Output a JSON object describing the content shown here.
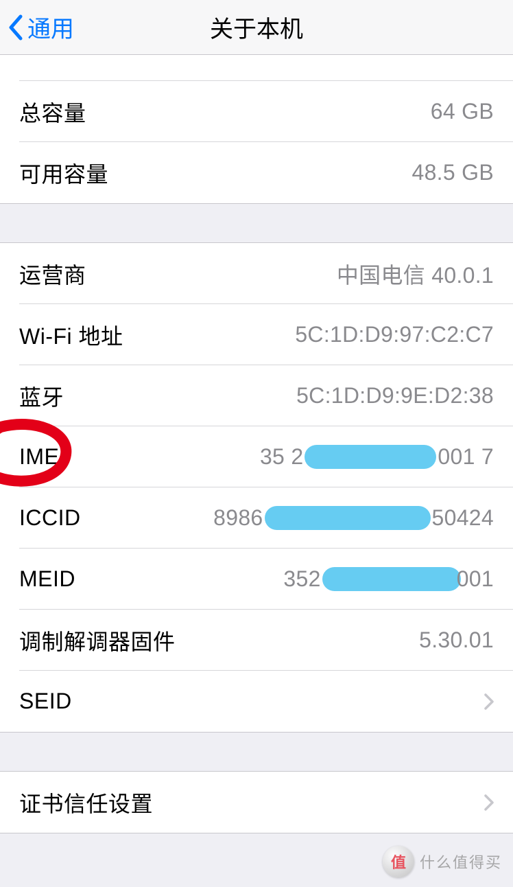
{
  "nav": {
    "back_label": "通用",
    "title": "关于本机"
  },
  "partial_row_label": "",
  "group1": [
    {
      "label": "总容量",
      "value": "64 GB"
    },
    {
      "label": "可用容量",
      "value": "48.5 GB"
    }
  ],
  "group2": [
    {
      "label": "运营商",
      "value": "中国电信 40.0.1"
    },
    {
      "label": "Wi-Fi 地址",
      "value": "5C:1D:D9:97:C2:C7"
    },
    {
      "label": "蓝牙",
      "value": "5C:1D:D9:9E:D2:38"
    },
    {
      "label": "IMEI",
      "value_prefix": "35 2",
      "value_suffix": "001 7",
      "redacted_width": 192,
      "circled": true
    },
    {
      "label": "ICCID",
      "value_prefix": "8986",
      "value_suffix": "50424",
      "redacted_width": 242
    },
    {
      "label": "MEID",
      "value_prefix": "352",
      "value_suffix": "001",
      "redacted_width": 202,
      "redact_offset_right": 8
    },
    {
      "label": "调制解调器固件",
      "value": "5.30.01"
    },
    {
      "label": "SEID",
      "disclosure": true
    }
  ],
  "group3": [
    {
      "label": "证书信任设置",
      "disclosure": true
    }
  ],
  "watermark": {
    "icon_text": "值",
    "text": "什么值得买"
  }
}
